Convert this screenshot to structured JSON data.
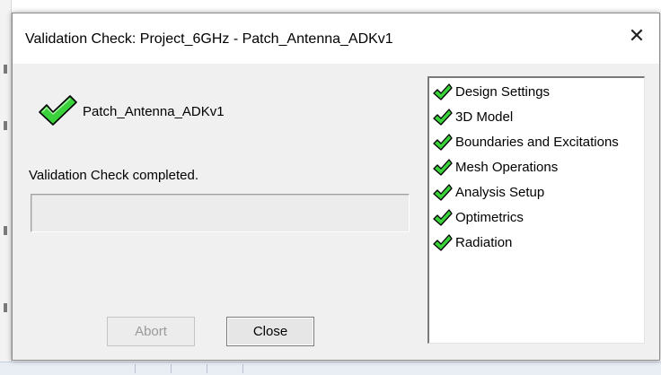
{
  "window": {
    "title": "Validation Check: Project_6GHz - Patch_Antenna_ADKv1",
    "close_glyph": "✕"
  },
  "project": {
    "name": "Patch_Antenna_ADKv1",
    "status_icon": "green-check-icon"
  },
  "status": {
    "message": "Validation Check completed.",
    "progress_fraction": 0
  },
  "buttons": {
    "abort_label": "Abort",
    "abort_enabled": false,
    "close_label": "Close"
  },
  "checklist": {
    "items": [
      {
        "label": "Design Settings",
        "icon": "green-check-icon"
      },
      {
        "label": "3D Model",
        "icon": "green-check-icon"
      },
      {
        "label": "Boundaries and Excitations",
        "icon": "green-check-icon"
      },
      {
        "label": "Mesh Operations",
        "icon": "green-check-icon"
      },
      {
        "label": "Analysis Setup",
        "icon": "green-check-icon"
      },
      {
        "label": "Optimetrics",
        "icon": "green-check-icon"
      },
      {
        "label": "Radiation",
        "icon": "green-check-icon"
      }
    ]
  },
  "colors": {
    "check_fill": "#3ad13a",
    "check_outline": "#000000",
    "dialog_bg": "#f0f0f0"
  }
}
